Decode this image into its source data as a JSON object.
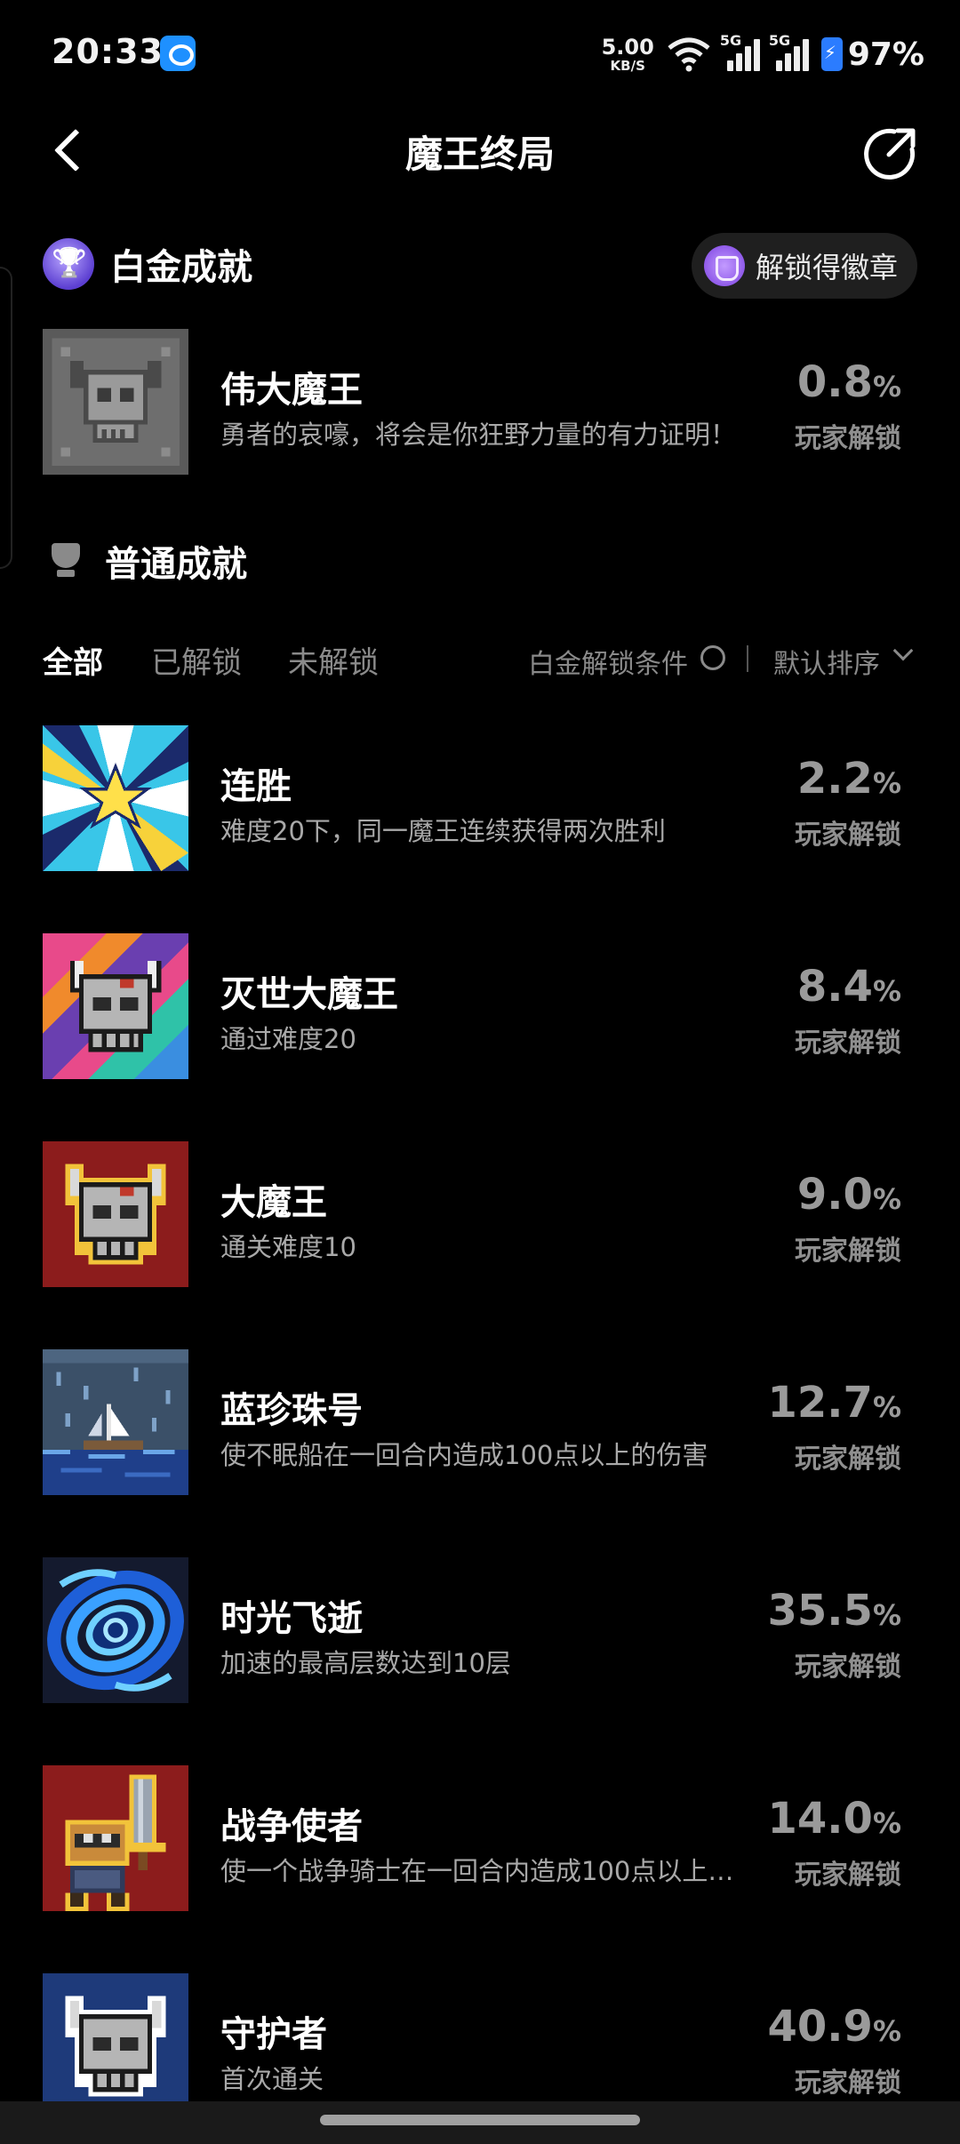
{
  "status_bar": {
    "time": "20:33",
    "net_speed": "5.00",
    "net_unit": "KB/S",
    "sim1": "5G",
    "sim2": "5G",
    "battery": "97%"
  },
  "header": {
    "title": "魔王终局"
  },
  "platinum": {
    "section_title": "白金成就",
    "badge_button": "解锁得徽章",
    "item": {
      "name": "伟大魔王",
      "desc": "勇者的哀嚎，将会是你狂野力量的有力证明！",
      "pct": "0.8",
      "pct_sign": "%",
      "sub": "玩家解锁"
    }
  },
  "normal": {
    "section_title": "普通成就"
  },
  "filters": {
    "tabs": [
      "全部",
      "已解锁",
      "未解锁"
    ],
    "active_tab": "全部",
    "condition_label": "白金解锁条件",
    "sort_label": "默认排序"
  },
  "achievements": [
    {
      "name": "连胜",
      "desc": "难度20下，同一魔王连续获得两次胜利",
      "pct": "2.2",
      "pct_sign": "%",
      "sub": "玩家解锁",
      "icon": "burst-star-icon"
    },
    {
      "name": "灭世大魔王",
      "desc": "通过难度20",
      "pct": "8.4",
      "pct_sign": "%",
      "sub": "玩家解锁",
      "icon": "rainbow-skull-icon"
    },
    {
      "name": "大魔王",
      "desc": "通关难度10",
      "pct": "9.0",
      "pct_sign": "%",
      "sub": "玩家解锁",
      "icon": "red-skull-icon"
    },
    {
      "name": "蓝珍珠号",
      "desc": "使不眠船在一回合内造成100点以上的伤害",
      "pct": "12.7",
      "pct_sign": "%",
      "sub": "玩家解锁",
      "icon": "ship-rain-icon"
    },
    {
      "name": "时光飞逝",
      "desc": "加速的最高层数达到10层",
      "pct": "35.5",
      "pct_sign": "%",
      "sub": "玩家解锁",
      "icon": "vortex-icon"
    },
    {
      "name": "战争使者",
      "desc": "使一个战争骑士在一回合内造成100点以上…",
      "pct": "14.0",
      "pct_sign": "%",
      "sub": "玩家解锁",
      "icon": "knight-sword-icon"
    },
    {
      "name": "守护者",
      "desc": "首次通关",
      "pct": "40.9",
      "pct_sign": "%",
      "sub": "玩家解锁",
      "icon": "blue-skull-icon"
    }
  ],
  "colors": {
    "background": "#000000",
    "muted_text": "#a9a9a9",
    "percent_text": "#9a9a9a",
    "accent_purple": "#7a3fe0"
  }
}
